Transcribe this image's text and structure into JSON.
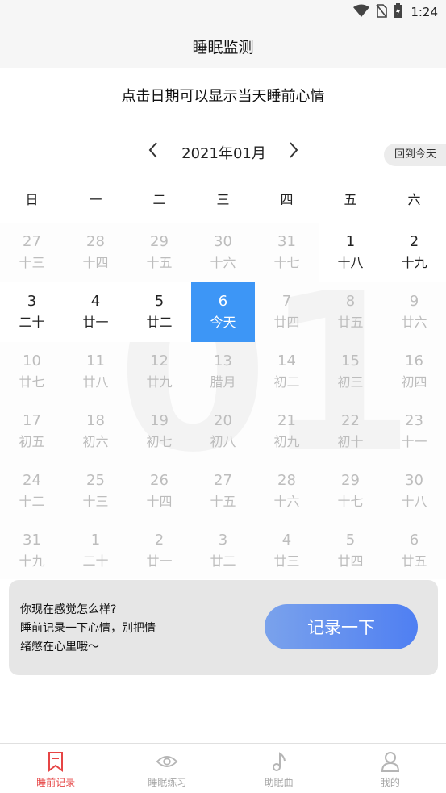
{
  "status_bar": {
    "time": "1:24",
    "icons": [
      "wifi-icon",
      "no-sim-icon",
      "battery-charging-icon"
    ]
  },
  "header": {
    "title": "睡眠监测"
  },
  "hint": "点击日期可以显示当天睡前心情",
  "calendar": {
    "month_label": "2021年01月",
    "today_button": "回到今天",
    "background_month": "01",
    "weekdays": [
      "日",
      "一",
      "二",
      "三",
      "四",
      "五",
      "六"
    ],
    "weeks": [
      [
        {
          "day": "27",
          "lunar": "十三",
          "state": "other"
        },
        {
          "day": "28",
          "lunar": "十四",
          "state": "other"
        },
        {
          "day": "29",
          "lunar": "十五",
          "state": "other"
        },
        {
          "day": "30",
          "lunar": "十六",
          "state": "other"
        },
        {
          "day": "31",
          "lunar": "十七",
          "state": "other"
        },
        {
          "day": "1",
          "lunar": "十八",
          "state": "cur"
        },
        {
          "day": "2",
          "lunar": "十九",
          "state": "cur"
        }
      ],
      [
        {
          "day": "3",
          "lunar": "二十",
          "state": "cur"
        },
        {
          "day": "4",
          "lunar": "廿一",
          "state": "cur"
        },
        {
          "day": "5",
          "lunar": "廿二",
          "state": "cur"
        },
        {
          "day": "6",
          "lunar": "今天",
          "state": "selected"
        },
        {
          "day": "7",
          "lunar": "廿四",
          "state": "dim"
        },
        {
          "day": "8",
          "lunar": "廿五",
          "state": "dim"
        },
        {
          "day": "9",
          "lunar": "廿六",
          "state": "dim"
        }
      ],
      [
        {
          "day": "10",
          "lunar": "廿七",
          "state": "dim"
        },
        {
          "day": "11",
          "lunar": "廿八",
          "state": "dim"
        },
        {
          "day": "12",
          "lunar": "廿九",
          "state": "dim"
        },
        {
          "day": "13",
          "lunar": "腊月",
          "state": "dim"
        },
        {
          "day": "14",
          "lunar": "初二",
          "state": "dim"
        },
        {
          "day": "15",
          "lunar": "初三",
          "state": "dim"
        },
        {
          "day": "16",
          "lunar": "初四",
          "state": "dim"
        }
      ],
      [
        {
          "day": "17",
          "lunar": "初五",
          "state": "dim"
        },
        {
          "day": "18",
          "lunar": "初六",
          "state": "dim"
        },
        {
          "day": "19",
          "lunar": "初七",
          "state": "dim"
        },
        {
          "day": "20",
          "lunar": "初八",
          "state": "dim"
        },
        {
          "day": "21",
          "lunar": "初九",
          "state": "dim"
        },
        {
          "day": "22",
          "lunar": "初十",
          "state": "dim"
        },
        {
          "day": "23",
          "lunar": "十一",
          "state": "dim"
        }
      ],
      [
        {
          "day": "24",
          "lunar": "十二",
          "state": "dim"
        },
        {
          "day": "25",
          "lunar": "十三",
          "state": "dim"
        },
        {
          "day": "26",
          "lunar": "十四",
          "state": "dim"
        },
        {
          "day": "27",
          "lunar": "十五",
          "state": "dim"
        },
        {
          "day": "28",
          "lunar": "十六",
          "state": "dim"
        },
        {
          "day": "29",
          "lunar": "十七",
          "state": "dim"
        },
        {
          "day": "30",
          "lunar": "十八",
          "state": "dim"
        }
      ],
      [
        {
          "day": "31",
          "lunar": "十九",
          "state": "dim"
        },
        {
          "day": "1",
          "lunar": "二十",
          "state": "other"
        },
        {
          "day": "2",
          "lunar": "廿一",
          "state": "other"
        },
        {
          "day": "3",
          "lunar": "廿二",
          "state": "other"
        },
        {
          "day": "4",
          "lunar": "廿三",
          "state": "other"
        },
        {
          "day": "5",
          "lunar": "廿四",
          "state": "other"
        },
        {
          "day": "6",
          "lunar": "廿五",
          "state": "other"
        }
      ]
    ]
  },
  "mood_card": {
    "line1": "你现在感觉怎么样?",
    "line2": "睡前记录一下心情，别把情",
    "line3": "绪憋在心里哦～",
    "button": "记录一下"
  },
  "tabs": [
    {
      "label": "睡前记录",
      "icon": "bookmark-icon",
      "active": true
    },
    {
      "label": "睡眠练习",
      "icon": "eye-icon",
      "active": false
    },
    {
      "label": "助眠曲",
      "icon": "music-note-icon",
      "active": false
    },
    {
      "label": "我的",
      "icon": "user-icon",
      "active": false
    }
  ],
  "colors": {
    "selected": "#3d96f6",
    "tab_active": "#e64545",
    "button_start": "#7aa2ec",
    "button_end": "#4f7ff2"
  }
}
